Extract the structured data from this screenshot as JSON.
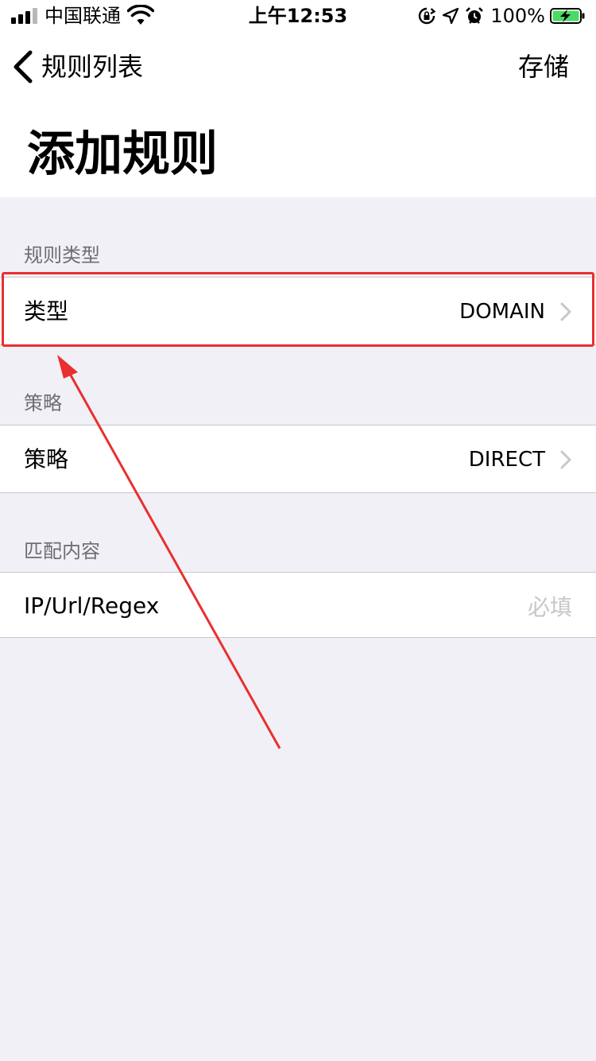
{
  "status_bar": {
    "carrier": "中国联通",
    "time": "上午12:53",
    "battery_percent": "100%",
    "icons": [
      "signal-icon",
      "wifi-icon",
      "orientation-lock-icon",
      "location-icon",
      "alarm-icon",
      "battery-charging-icon"
    ]
  },
  "nav": {
    "back_label": "规则列表",
    "save_label": "存储",
    "title": "添加规则"
  },
  "sections": {
    "rule_type": {
      "header": "规则类型",
      "cell_label": "类型",
      "cell_value": "DOMAIN"
    },
    "policy": {
      "header": "策略",
      "cell_label": "策略",
      "cell_value": "DIRECT"
    },
    "match": {
      "header": "匹配内容",
      "cell_label": "IP/Url/Regex",
      "input_value": "",
      "input_placeholder": "必填"
    }
  },
  "annotation": {
    "highlight_color": "#e8302e",
    "arrow_color": "#e8302e"
  },
  "colors": {
    "background": "#f1f0f6",
    "cell_background": "#ffffff",
    "secondary_text": "#6d6d72",
    "placeholder": "#c7c7cc",
    "battery_green": "#4cd964"
  }
}
